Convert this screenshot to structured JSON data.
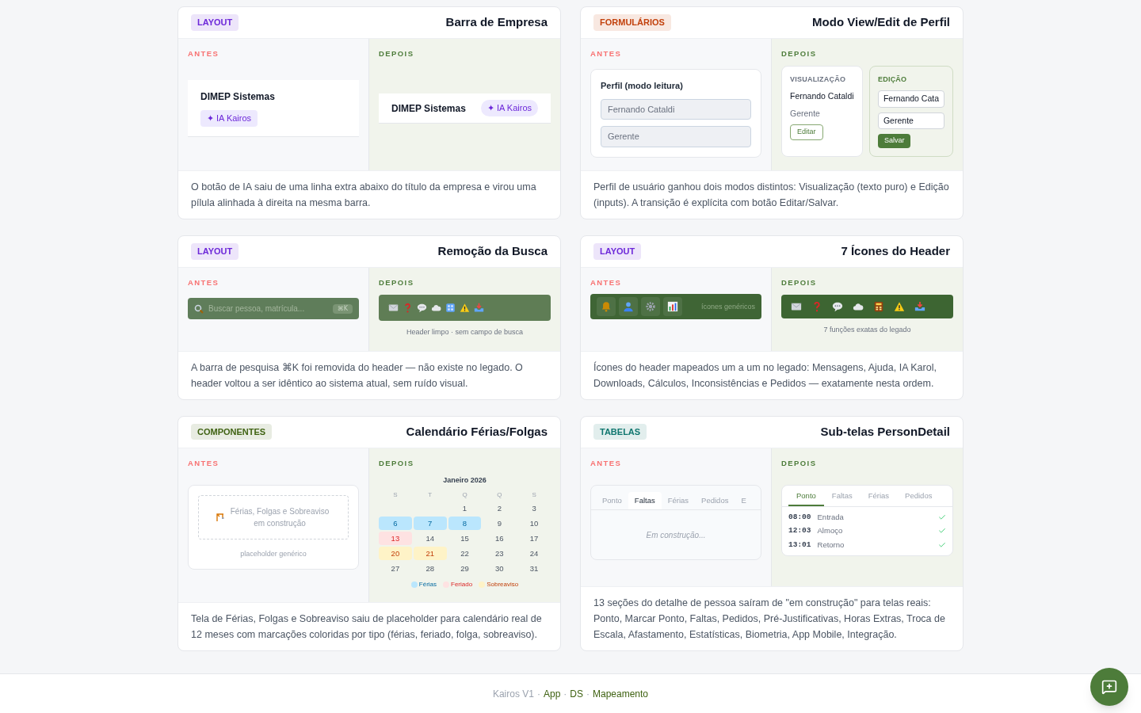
{
  "cards": [
    {
      "tag": {
        "label": "LAYOUT",
        "color": "#6d28d9"
      },
      "title": "Barra de Empresa",
      "before": {
        "label": "ANTES",
        "kind": "company-stacked",
        "company": "DIMEP Sistemas",
        "pill": "✦ IA Kairos"
      },
      "after": {
        "label": "DEPOIS",
        "kind": "company-inline",
        "company": "DIMEP Sistemas",
        "pill": "✦ IA Kairos"
      },
      "description": "O botão de IA saiu de uma linha extra abaixo do título da empresa e virou uma pílula alinhada à direita na mesma barra."
    },
    {
      "tag": {
        "label": "FORMULÁRIOS",
        "color": "#c2410c"
      },
      "title": "Modo View/Edit de Perfil",
      "before": {
        "label": "ANTES",
        "kind": "profile-readonly",
        "heading": "Perfil (modo leitura)",
        "fields": [
          "Fernando Cataldi",
          "Gerente"
        ]
      },
      "after": {
        "label": "DEPOIS",
        "kind": "profile-modes",
        "view": {
          "heading": "VISUALIZAÇÃO",
          "name": "Fernando Cataldi",
          "role": "Gerente",
          "button": "Editar"
        },
        "edit": {
          "heading": "EDIÇÃO",
          "fields": [
            "Fernando Cata",
            "Gerente"
          ],
          "button": "Salvar"
        }
      },
      "description": "Perfil de usuário ganhou dois modos distintos: Visualização (texto puro) e Edição (inputs). A transição é explícita com botão Editar/Salvar."
    },
    {
      "tag": {
        "label": "LAYOUT",
        "color": "#6d28d9"
      },
      "title": "Remoção da Busca",
      "before": {
        "label": "ANTES",
        "kind": "search-bar",
        "placeholder": "Buscar pessoa, matrícula...",
        "shortcut": "⌘K"
      },
      "after": {
        "label": "DEPOIS",
        "kind": "legacy-icons",
        "caption": "Header limpo · sem campo de busca"
      },
      "description": "A barra de pesquisa ⌘K foi removida do header — não existe no legado. O header voltou a ser idêntico ao sistema atual, sem ruído visual."
    },
    {
      "tag": {
        "label": "LAYOUT",
        "color": "#6d28d9"
      },
      "title": "7 Ícones do Header",
      "before": {
        "label": "ANTES",
        "kind": "generic-icons",
        "caption": "ícones genéricos"
      },
      "after": {
        "label": "DEPOIS",
        "kind": "legacy-icons-wide",
        "caption": "7 funções exatas do legado"
      },
      "description": "Ícones do header mapeados um a um no legado: Mensagens, Ajuda, IA Karol, Downloads, Cálculos, Inconsistências e Pedidos — exatamente nesta ordem."
    },
    {
      "tag": {
        "label": "COMPONENTES",
        "color": "#3f6212"
      },
      "title": "Calendário Férias/Folgas",
      "before": {
        "label": "ANTES",
        "kind": "placeholder",
        "text": "Férias, Folgas e Sobreaviso em construção",
        "caption": "placeholder genérico"
      },
      "after": {
        "label": "DEPOIS",
        "kind": "calendar",
        "month": "Janeiro 2026",
        "weekdays": [
          "S",
          "T",
          "Q",
          "Q",
          "S"
        ],
        "weeks": [
          [
            {
              "day": "1",
              "kind": "plain"
            },
            {
              "day": "2",
              "kind": "plain"
            },
            {
              "day": "3",
              "kind": "plain"
            }
          ],
          [
            {
              "day": "6",
              "kind": "ferias"
            },
            {
              "day": "7",
              "kind": "ferias"
            },
            {
              "day": "8",
              "kind": "ferias"
            },
            {
              "day": "9",
              "kind": "plain"
            },
            {
              "day": "10",
              "kind": "plain"
            }
          ],
          [
            {
              "day": "13",
              "kind": "feriado"
            },
            {
              "day": "14",
              "kind": "plain"
            },
            {
              "day": "15",
              "kind": "plain"
            },
            {
              "day": "16",
              "kind": "plain"
            },
            {
              "day": "17",
              "kind": "plain"
            }
          ],
          [
            {
              "day": "20",
              "kind": "sobreaviso"
            },
            {
              "day": "21",
              "kind": "sobreaviso"
            },
            {
              "day": "22",
              "kind": "plain"
            },
            {
              "day": "23",
              "kind": "plain"
            },
            {
              "day": "24",
              "kind": "plain"
            }
          ],
          [
            {
              "day": "27",
              "kind": "plain"
            },
            {
              "day": "28",
              "kind": "plain"
            },
            {
              "day": "29",
              "kind": "plain"
            },
            {
              "day": "30",
              "kind": "plain"
            },
            {
              "day": "31",
              "kind": "plain"
            }
          ]
        ],
        "legend": [
          {
            "label": "Férias",
            "kind": "ferias"
          },
          {
            "label": "Feriado",
            "kind": "feriado"
          },
          {
            "label": "Sobreaviso",
            "kind": "sobreaviso"
          }
        ]
      },
      "description": "Tela de Férias, Folgas e Sobreaviso saiu de placeholder para calendário real de 12 meses com marcações coloridas por tipo (férias, feriado, folga, sobreaviso)."
    },
    {
      "tag": {
        "label": "TABELAS",
        "color": "#0f766e"
      },
      "title": "Sub-telas PersonDetail",
      "before": {
        "label": "ANTES",
        "kind": "tabs-placeholder",
        "tabs": [
          {
            "label": "Ponto",
            "selected": false
          },
          {
            "label": "Faltas",
            "selected": true
          },
          {
            "label": "Férias",
            "selected": false
          },
          {
            "label": "Pedidos",
            "selected": false
          },
          {
            "label": "E",
            "selected": false
          }
        ],
        "text": "Em construção..."
      },
      "after": {
        "label": "DEPOIS",
        "kind": "tabs-punches",
        "tabs": [
          {
            "label": "Ponto",
            "selected": true
          },
          {
            "label": "Faltas",
            "selected": false
          },
          {
            "label": "Férias",
            "selected": false
          },
          {
            "label": "Pedidos",
            "selected": false
          }
        ],
        "punches": [
          {
            "time": "08:00",
            "label": "Entrada",
            "checked": true
          },
          {
            "time": "12:03",
            "label": "Almoço",
            "checked": true
          },
          {
            "time": "13:01",
            "label": "Retorno",
            "checked": true
          }
        ]
      },
      "description": "13 seções do detalhe de pessoa saíram de \"em construção\" para telas reais: Ponto, Marcar Ponto, Faltas, Pedidos, Pré-Justificativas, Horas Extras, Troca de Escala, Afastamento, Estatísticas, Biometria, App Mobile, Integração."
    }
  ],
  "footer": {
    "brand": "Kairos V1",
    "separator": "·",
    "links": [
      "App",
      "DS",
      "Mapeamento"
    ]
  }
}
